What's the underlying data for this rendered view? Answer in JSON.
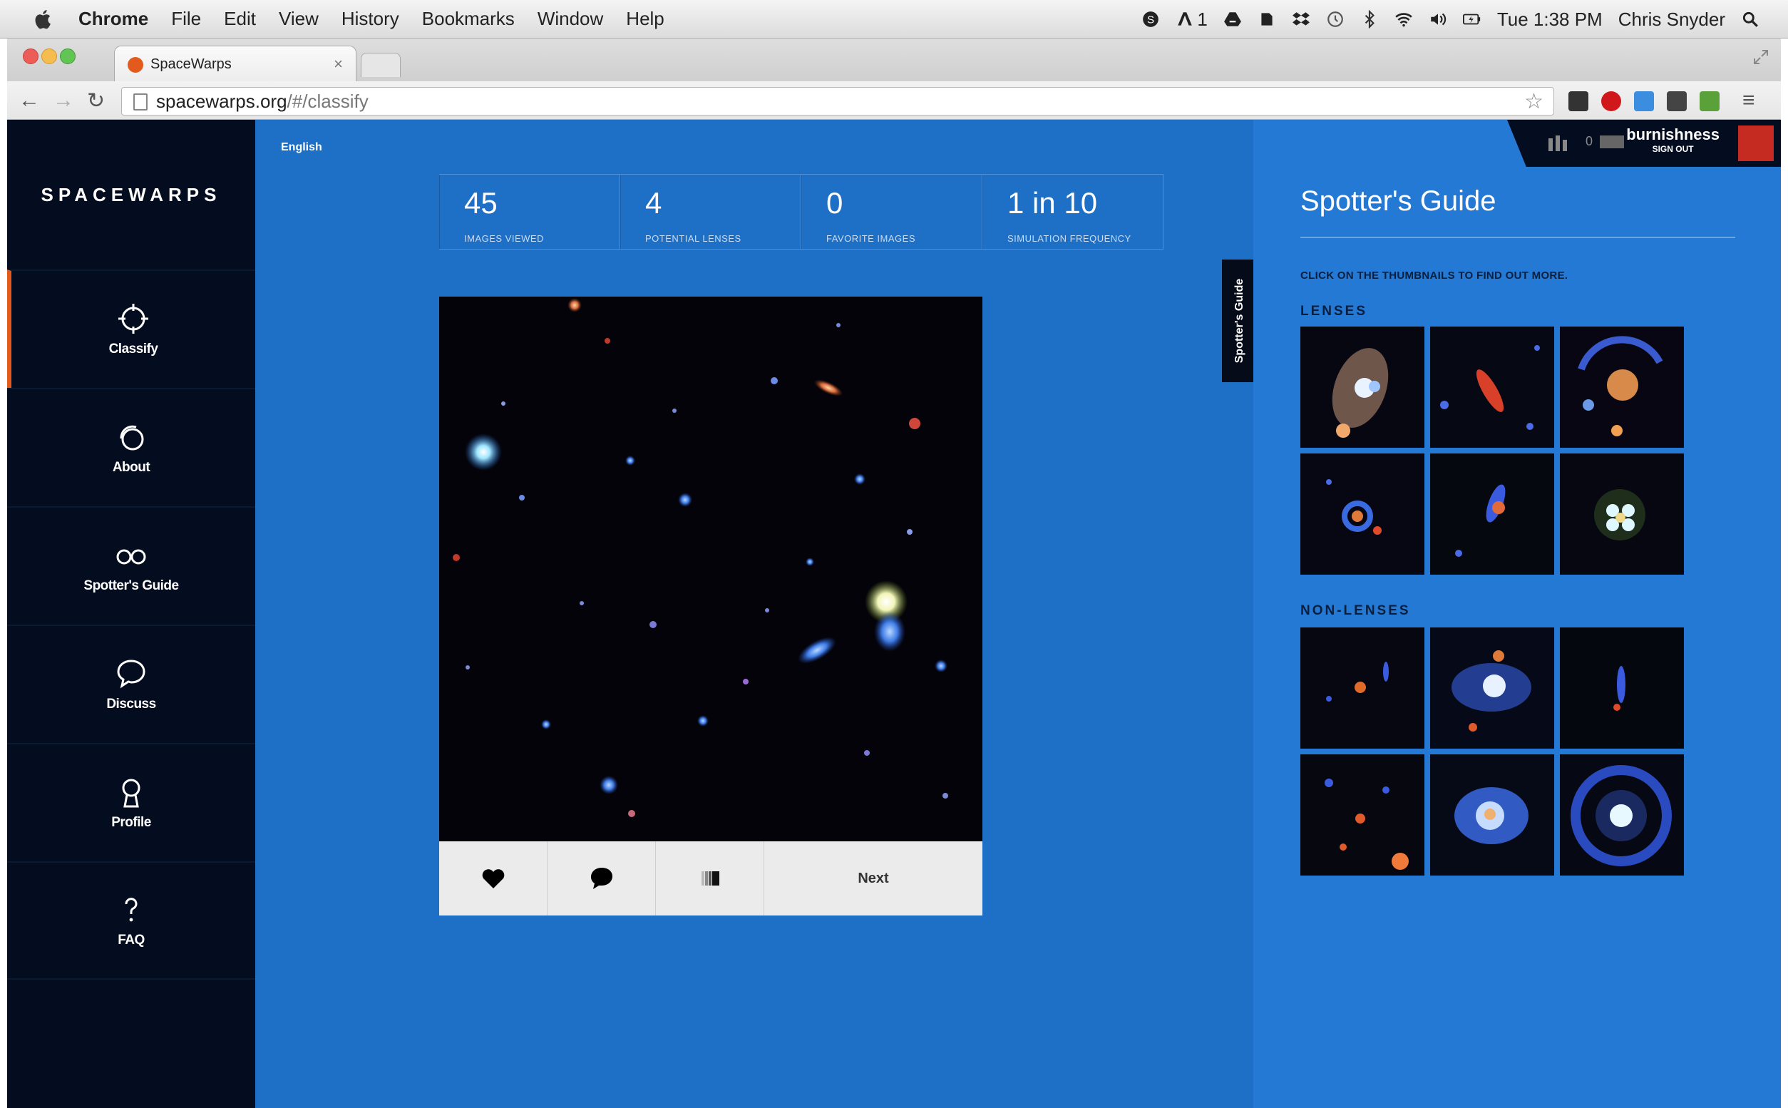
{
  "menubar": {
    "app": "Chrome",
    "items": [
      "File",
      "Edit",
      "View",
      "History",
      "Bookmarks",
      "Window",
      "Help"
    ],
    "adobe_count": "1",
    "clock": "Tue 1:38 PM",
    "user": "Chris Snyder"
  },
  "browser": {
    "tab_title": "SpaceWarps",
    "url_host": "spacewarps.org",
    "url_path": "/#/classify"
  },
  "sidebar": {
    "brand": "SPACEWARPS",
    "items": [
      {
        "label": "Classify",
        "icon": "crosshair-icon"
      },
      {
        "label": "About",
        "icon": "circles-icon"
      },
      {
        "label": "Spotter's Guide",
        "icon": "glasses-icon"
      },
      {
        "label": "Discuss",
        "icon": "speech-bubble-icon"
      },
      {
        "label": "Profile",
        "icon": "person-icon"
      },
      {
        "label": "FAQ",
        "icon": "question-icon"
      }
    ]
  },
  "main": {
    "language": "English",
    "stats": [
      {
        "value": "45",
        "caption": "IMAGES VIEWED"
      },
      {
        "value": "4",
        "caption": "POTENTIAL LENSES"
      },
      {
        "value": "0",
        "caption": "FAVORITE IMAGES"
      },
      {
        "value": "1 in 10",
        "caption": "SIMULATION FREQUENCY"
      }
    ],
    "next_label": "Next",
    "guide_tab_label": "Spotter's Guide"
  },
  "user": {
    "name": "burnishness",
    "sign_out": "SIGN OUT",
    "score": "0"
  },
  "guide": {
    "title": "Spotter's Guide",
    "hint": "CLICK ON THE THUMBNAILS TO FIND OUT MORE.",
    "lenses_heading": "LENSES",
    "nonlenses_heading": "NON-LENSES"
  },
  "colors": {
    "page_blue": "#1e6fc6",
    "sidebar": "#040d1f",
    "accent": "#e25b1d",
    "guide_blue": "#2479d4"
  }
}
